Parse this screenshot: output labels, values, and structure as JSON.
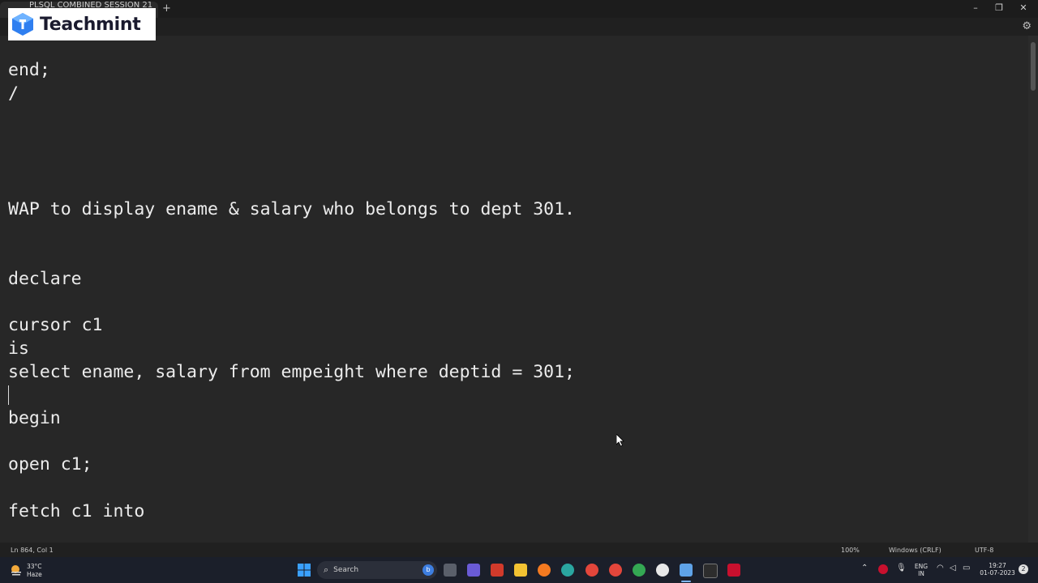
{
  "window": {
    "tab_title": "PLSQL COMBINED SESSION 21 ...",
    "new_tab": "+",
    "minimize": "–",
    "maximize": "❐",
    "close": "✕"
  },
  "logo": {
    "text": "Teachmint"
  },
  "editor": {
    "lines": [
      "end;",
      "/",
      "WAP to display ename & salary who belongs to dept 301.",
      "declare",
      "cursor c1",
      "is",
      "select ename, salary from empeight where deptid = 301;",
      "begin",
      "open c1;",
      "fetch c1 into"
    ]
  },
  "status": {
    "position": "Ln 864, Col 1",
    "zoom": "100%",
    "line_ending": "Windows (CRLF)",
    "encoding": "UTF-8"
  },
  "taskbar": {
    "weather_temp": "33°C",
    "weather_desc": "Haze",
    "search_label": "Search",
    "lang_line1": "ENG",
    "lang_line2": "IN",
    "time": "19:27",
    "date": "01-07-2023",
    "notification_count": "2"
  },
  "colors": {
    "editor_bg": "#272727",
    "text": "#ececec",
    "taskbar_bg": "#1b1f2a"
  }
}
